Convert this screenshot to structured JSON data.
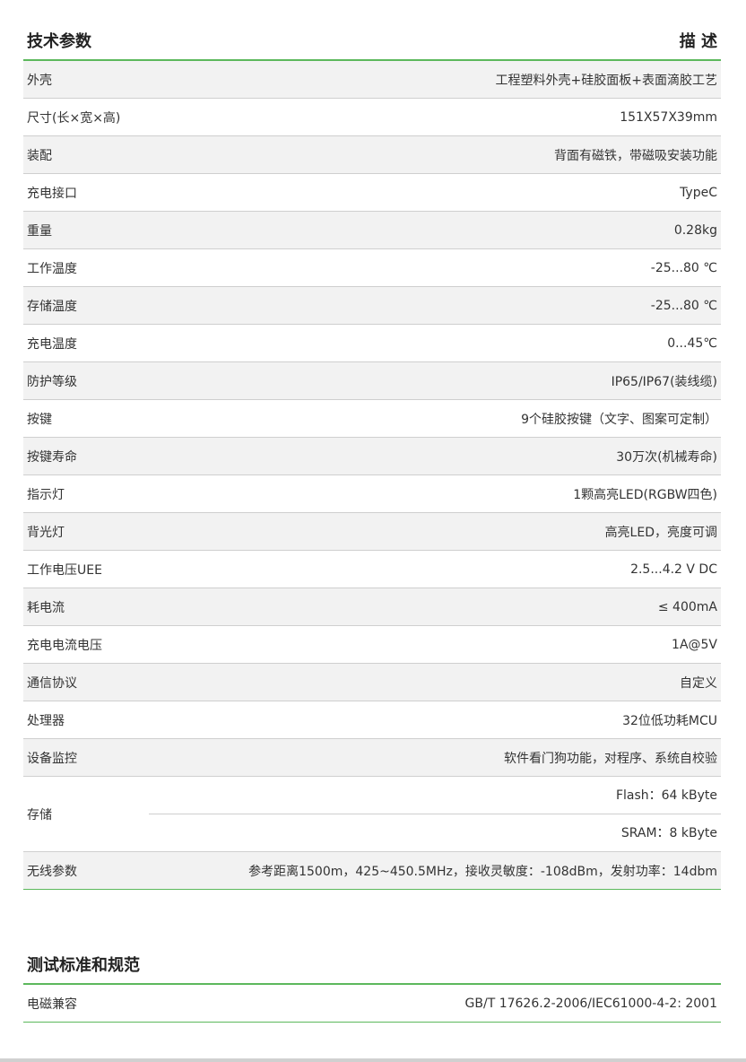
{
  "spec": {
    "title": "技术参数",
    "desc_title": "描 述",
    "rows": [
      {
        "label": "外壳",
        "value": "工程塑料外壳+硅胶面板+表面滴胶工艺"
      },
      {
        "label": "尺寸(长×宽×高)",
        "value": "151X57X39mm"
      },
      {
        "label": "装配",
        "value": "背面有磁铁，带磁吸安装功能"
      },
      {
        "label": "充电接口",
        "value": "TypeC"
      },
      {
        "label": "重量",
        "value": "0.28kg"
      },
      {
        "label": "工作温度",
        "value": "-25...80 ℃"
      },
      {
        "label": "存储温度",
        "value": "-25...80 ℃"
      },
      {
        "label": "充电温度",
        "value": "0...45℃"
      },
      {
        "label": "防护等级",
        "value": "IP65/IP67(装线缆)"
      },
      {
        "label": "按键",
        "value": "9个硅胶按键（文字、图案可定制）"
      },
      {
        "label": "按键寿命",
        "value": "30万次(机械寿命)"
      },
      {
        "label": "指示灯",
        "value": "1颗高亮LED(RGBW四色)"
      },
      {
        "label": "背光灯",
        "value": "高亮LED，亮度可调"
      },
      {
        "label": "工作电压UEE",
        "value": "2.5...4.2 V DC"
      },
      {
        "label": "耗电流",
        "value": "≤ 400mA"
      },
      {
        "label": "充电电流电压",
        "value": "1A@5V"
      },
      {
        "label": "通信协议",
        "value": "自定义"
      },
      {
        "label": "处理器",
        "value": "32位低功耗MCU"
      },
      {
        "label": "设备监控",
        "value": "软件看门狗功能，对程序、系统自校验"
      }
    ],
    "storage": {
      "label": "存储",
      "flash": "Flash：64 kByte",
      "sram": "SRAM：8 kByte"
    },
    "wireless": {
      "label": "无线参数",
      "value": "参考距离1500m，425~450.5MHz，接收灵敏度：-108dBm，发射功率：14dbm"
    }
  },
  "standards": {
    "title": "测试标准和规范",
    "rows": [
      {
        "label": "电磁兼容",
        "value": "GB/T 17626.2-2006/IEC61000-4-2: 2001"
      }
    ]
  },
  "colors": {
    "accent_green": "#5cb85c",
    "row_alt": "#f2f2f2"
  }
}
